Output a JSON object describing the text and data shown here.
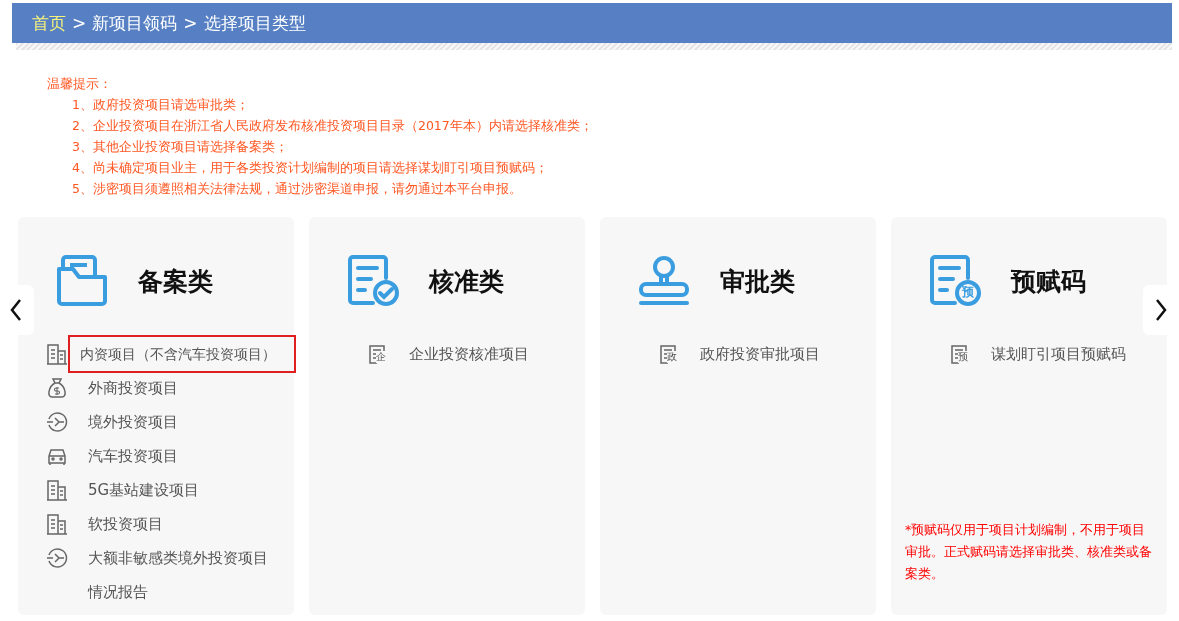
{
  "breadcrumb": [
    {
      "label": "首页",
      "kind": "link"
    },
    {
      "label": ">",
      "kind": "sep"
    },
    {
      "label": "新项目领码",
      "kind": "text"
    },
    {
      "label": ">",
      "kind": "sep"
    },
    {
      "label": "选择项目类型",
      "kind": "text"
    }
  ],
  "notice": {
    "title": "温馨提示：",
    "lines": [
      "1、政府投资项目请选审批类；",
      "2、企业投资项目在浙江省人民政府发布核准投资项目目录（2017年本）内请选择核准类；",
      "3、其他企业投资项目请选择备案类；",
      "4、尚未确定项目业主，用于各类投资计划编制的项目请选择谋划盯引项目预赋码；",
      "5、涉密项目须遵照相关法律法规，通过涉密渠道申报，请勿通过本平台申报。"
    ]
  },
  "cards": [
    {
      "title": "备案类",
      "kind": "folder",
      "items": [
        {
          "label": "内资项目（不含汽车投资项目）",
          "kind": "building",
          "selected": true
        },
        {
          "label": "外商投资项目",
          "kind": "bag",
          "selected": false
        },
        {
          "label": "境外投资项目",
          "kind": "globe",
          "selected": false
        },
        {
          "label": "汽车投资项目",
          "kind": "car",
          "selected": false
        },
        {
          "label": "5G基站建设项目",
          "kind": "building",
          "selected": false
        },
        {
          "label": "软投资项目",
          "kind": "building",
          "selected": false
        },
        {
          "label": "大额非敏感类境外投资项目情况报告",
          "kind": "globe",
          "selected": false
        }
      ]
    },
    {
      "title": "核准类",
      "kind": "check",
      "items": [
        {
          "label": "企业投资核准项目",
          "kind": "document",
          "icon_text": "企",
          "selected": false
        }
      ]
    },
    {
      "title": "审批类",
      "kind": "stamp",
      "items": [
        {
          "label": "政府投资审批项目",
          "kind": "document",
          "icon_text": "政",
          "selected": false
        }
      ]
    },
    {
      "title": "预赋码",
      "kind": "badge",
      "icon_text": "预",
      "items": [
        {
          "label": "谋划盯引项目预赋码",
          "kind": "document",
          "icon_text": "预",
          "selected": false
        }
      ],
      "note": "*预赋码仅用于项目计划编制，不用于项目审批。正式赋码请选择审批类、核准类或备案类。"
    }
  ]
}
